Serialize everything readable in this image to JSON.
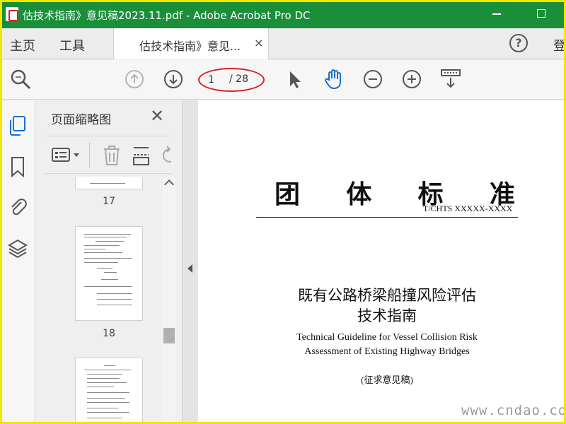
{
  "window": {
    "title": "估技术指南》意见稿2023.11.pdf - Adobe Acrobat Pro DC",
    "title_bar_color": "#1b8e3a"
  },
  "tabs": {
    "home": "主页",
    "tools": "工具",
    "document": "估技术指南》意见...",
    "close_symbol": "×",
    "help_symbol": "?",
    "signin": "登"
  },
  "toolbar": {
    "current_page": "1",
    "total_pages": "/ 28",
    "icons": [
      "search-zoom-icon",
      "page-up-icon",
      "page-down-icon",
      "select-cursor-icon",
      "hand-tool-icon",
      "zoom-out-icon",
      "zoom-in-icon",
      "scroll-mode-icon"
    ]
  },
  "sidebar": {
    "icons": [
      "pages-icon",
      "bookmark-icon",
      "attachment-icon",
      "layers-icon"
    ]
  },
  "thumbnail_panel": {
    "title": "页面缩略图",
    "close_symbol": "✕",
    "pages": [
      "17",
      "18"
    ]
  },
  "document": {
    "heading": [
      "团",
      "体",
      "标",
      "准"
    ],
    "code": "T/CHTS XXXXX-XXXX",
    "title_cn_line1": "既有公路桥梁船撞风险评估",
    "title_cn_line2": "技术指南",
    "title_en_line1": "Technical Guideline for Vessel Collision Risk",
    "title_en_line2": "Assessment of Existing Highway Bridges",
    "note": "(征求意见稿)"
  },
  "watermark": "www.cndao.com",
  "accent_colors": {
    "annotation_oval": "#d42020",
    "hand_tool": "#1a6fd0",
    "sidebar_active": "#1a6fd0"
  }
}
